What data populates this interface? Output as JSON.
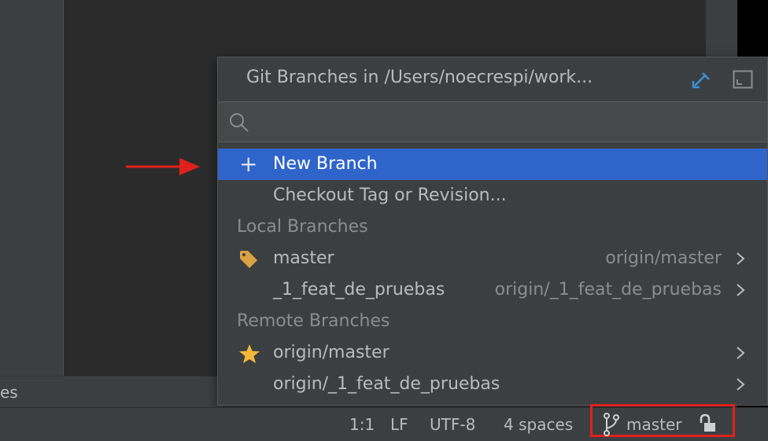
{
  "ide": {
    "tool_window_label": "es"
  },
  "popup": {
    "title": "Git Branches in /Users/noecrespi/work...",
    "search_value": "",
    "actions": [
      {
        "label": "New Branch",
        "icon": "plus-icon",
        "selected": true
      },
      {
        "label": "Checkout Tag or Revision..."
      }
    ],
    "local_header": "Local Branches",
    "local_branches": [
      {
        "name": "master",
        "tracking": "origin/master",
        "icon": "tag-icon"
      },
      {
        "name": "_1_feat_de_pruebas",
        "tracking": "origin/_1_feat_de_pruebas"
      }
    ],
    "remote_header": "Remote Branches",
    "remote_branches": [
      {
        "name": "origin/master",
        "icon": "star-icon"
      },
      {
        "name": "origin/_1_feat_de_pruebas"
      }
    ]
  },
  "status_bar": {
    "position": "1:1",
    "line_separator": "LF",
    "encoding": "UTF-8",
    "indent": "4 spaces",
    "branch": "master"
  },
  "colors": {
    "selection": "#2f65ca",
    "highlight_border": "#e0201c",
    "arrow": "#e0201c",
    "tag": "#d9a343",
    "star": "#f4b73b",
    "pin": "#3d8fd6"
  }
}
